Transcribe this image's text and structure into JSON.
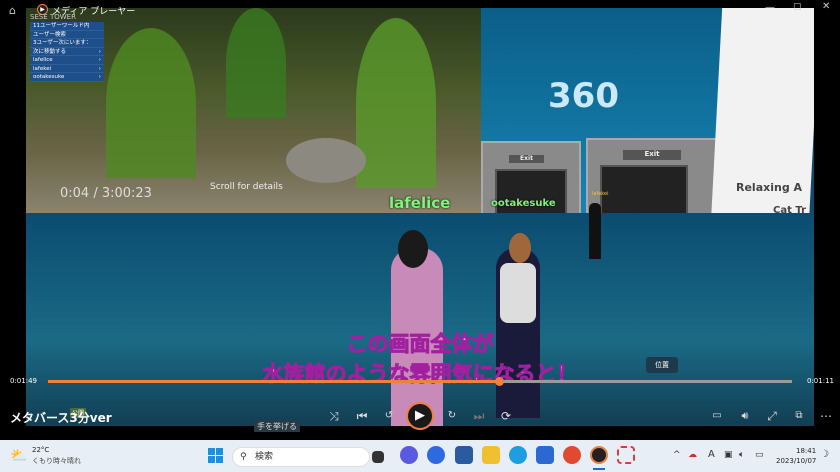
{
  "window": {
    "title": "メディア プレーヤー",
    "controls": [
      "minimize",
      "maximize",
      "close"
    ]
  },
  "overlay_menu": {
    "header": "SESE TOWER",
    "items": [
      "11ユーザーワールド内",
      "ユーザー検索",
      "3ユーザー次にいます：",
      "次に移動する",
      "lafelice",
      "lafekei",
      "ootakesuke"
    ]
  },
  "video_content": {
    "embedded_time": "0:04 / 3:00:23",
    "scroll_hint": "Scroll for details",
    "avatar_names": [
      "lafelice",
      "ootakesuke",
      "lafekei"
    ],
    "sign_360": "360",
    "exit_labels": [
      "Exit",
      "Exit"
    ],
    "panel_title": "Relaxing A",
    "panel_item": "Cat Tr",
    "subtitle_line1": "この画面全体が",
    "subtitle_line2": "水族館のような雰囲気になると！",
    "tooltip": "位置",
    "chat_badge": "公開",
    "raise_hand": "手を挙げる"
  },
  "player": {
    "elapsed": "0:01:49",
    "remaining": "0:01:11",
    "progress": 0.606,
    "media_title": "メタバース3分ver",
    "accent": "#f08040"
  },
  "taskbar": {
    "weather_temp": "22°C",
    "weather_desc": "くもり時々晴れ",
    "search_placeholder": "検索",
    "time": "18:41",
    "date": "2023/10/07",
    "ime": "A"
  }
}
